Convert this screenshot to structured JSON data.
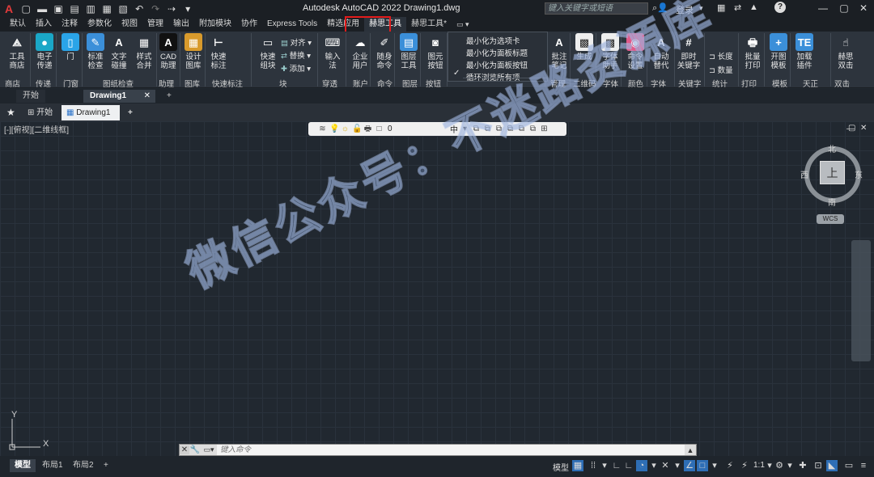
{
  "titlebar": {
    "app_logo": "A",
    "title": "Autodesk AutoCAD 2022    Drawing1.dwg",
    "search_placeholder": "键入关键字或短语",
    "login": "登录",
    "help": "?"
  },
  "tabs": [
    "默认",
    "插入",
    "注释",
    "参数化",
    "视图",
    "管理",
    "输出",
    "附加模块",
    "协作",
    "Express Tools",
    "精选应用",
    "赫思工具",
    "赫思工具*"
  ],
  "active_tab": "赫思工具",
  "ribbon": {
    "buttons": [
      {
        "label": "工具\n商店",
        "icon": "app-store-icon",
        "glyph": "⟁",
        "color": "#2d343d"
      },
      {
        "label": "电子\n传递",
        "icon": "etransmit-icon",
        "glyph": "●",
        "color": "#1aa7c7"
      },
      {
        "label": "门\n",
        "icon": "door-icon",
        "glyph": "▯",
        "color": "#2aa4e8"
      },
      {
        "label": "标准\n检查",
        "icon": "standards-check-icon",
        "glyph": "✎",
        "color": "#3b8fd9"
      },
      {
        "label": "文字\n碰撞",
        "icon": "text-collide-icon",
        "glyph": "A",
        "color": "#2d343d"
      },
      {
        "label": "样式\n合并",
        "icon": "style-merge-icon",
        "glyph": "▦",
        "color": "#2d343d"
      },
      {
        "label": "CAD\n助理",
        "icon": "cad-assistant-icon",
        "glyph": "A",
        "color": "#111"
      },
      {
        "label": "设计\n图库",
        "icon": "design-library-icon",
        "glyph": "▦",
        "color": "#d89a2c"
      },
      {
        "label": "快速\n标注",
        "icon": "quick-dim-icon",
        "glyph": "⊢",
        "color": "#2d343d"
      },
      {
        "label": "快速\n组块",
        "icon": "quick-block-icon",
        "glyph": "▭",
        "color": "#2d343d"
      },
      {
        "label": "输入\n法",
        "icon": "ime-icon",
        "glyph": "⌨",
        "color": "#2d343d"
      },
      {
        "label": "企业\n用户",
        "icon": "enterprise-user-icon",
        "glyph": "☁",
        "color": "#2d343d"
      },
      {
        "label": "随身\n命令",
        "icon": "portable-command-icon",
        "glyph": "✐",
        "color": "#2d343d"
      },
      {
        "label": "图层\n工具",
        "icon": "layer-tools-icon",
        "glyph": "▤",
        "color": "#3b8fd9"
      },
      {
        "label": "图元\n按钮",
        "icon": "entity-button-icon",
        "glyph": "◙",
        "color": "#2d343d"
      },
      {
        "label": "批注\n笔记",
        "icon": "annotation-note-icon",
        "glyph": "A",
        "color": "#2d343d"
      },
      {
        "label": "生成",
        "icon": "qrcode-icon",
        "glyph": "▩",
        "color": "#eee"
      },
      {
        "label": "字体\n助手",
        "icon": "font-assistant-icon",
        "glyph": "▩",
        "color": "#eee"
      },
      {
        "label": "命令\n设置",
        "icon": "command-settings-icon",
        "glyph": "◉",
        "color": "#e05a8a"
      },
      {
        "label": "自动\n替代",
        "icon": "auto-replace-icon",
        "glyph": "A",
        "color": "#2d343d"
      },
      {
        "label": "即时\n关键字",
        "icon": "keyword-icon",
        "glyph": "#",
        "color": "#2d343d"
      },
      {
        "label": "批量\n打印",
        "icon": "batch-print-icon",
        "glyph": "🖶",
        "color": "#2d343d"
      },
      {
        "label": "开图\n模板",
        "icon": "open-template-icon",
        "glyph": "+",
        "color": "#3b8fd9"
      },
      {
        "label": "加载\n插件",
        "icon": "load-plugin-icon",
        "glyph": "TE",
        "color": "#3b8fd9"
      },
      {
        "label": "赫思\n双击",
        "icon": "double-click-icon",
        "glyph": "☝",
        "color": "#2d343d"
      }
    ],
    "small_buttons": {
      "align": "对齐",
      "replace": "替换",
      "add": "添加",
      "length": "长度",
      "count": "数量"
    },
    "panels": [
      "商店",
      "传递",
      "门窗",
      "图纸检查",
      "助理",
      "图库",
      "快速标注",
      "块",
      "穿透",
      "账户",
      "命令",
      "图层",
      "按钮",
      "管理",
      "二维码",
      "字体",
      "颜色",
      "字体",
      "关键字",
      "统计",
      "打印",
      "模板",
      "天正",
      "双击"
    ]
  },
  "dropdown": {
    "items": [
      "最小化为选项卡",
      "最小化为面板标题",
      "最小化为面板按钮",
      "循环浏览所有项"
    ],
    "checked": "最小化为面板按钮"
  },
  "doc_tabs_top": [
    "开始",
    "Drawing1"
  ],
  "doc_tabs": {
    "start": "开始",
    "drawing": "Drawing1",
    "add": "+"
  },
  "viewport_label": "[-][俯视][二维线框]",
  "layer_toolbar": {
    "layer_value": "0",
    "middle": "中"
  },
  "viewcube": {
    "north": "北",
    "south": "南",
    "east": "东",
    "west": "西",
    "face": "上",
    "wcs": "WCS"
  },
  "ucs": {
    "x": "X",
    "y": "Y"
  },
  "watermark": "微信公众号：不迷路资源库",
  "command_line": {
    "placeholder": "键入命令"
  },
  "status": {
    "layouts": [
      "模型",
      "布局1",
      "布局2"
    ],
    "model": "模型",
    "scale": "1:1"
  }
}
